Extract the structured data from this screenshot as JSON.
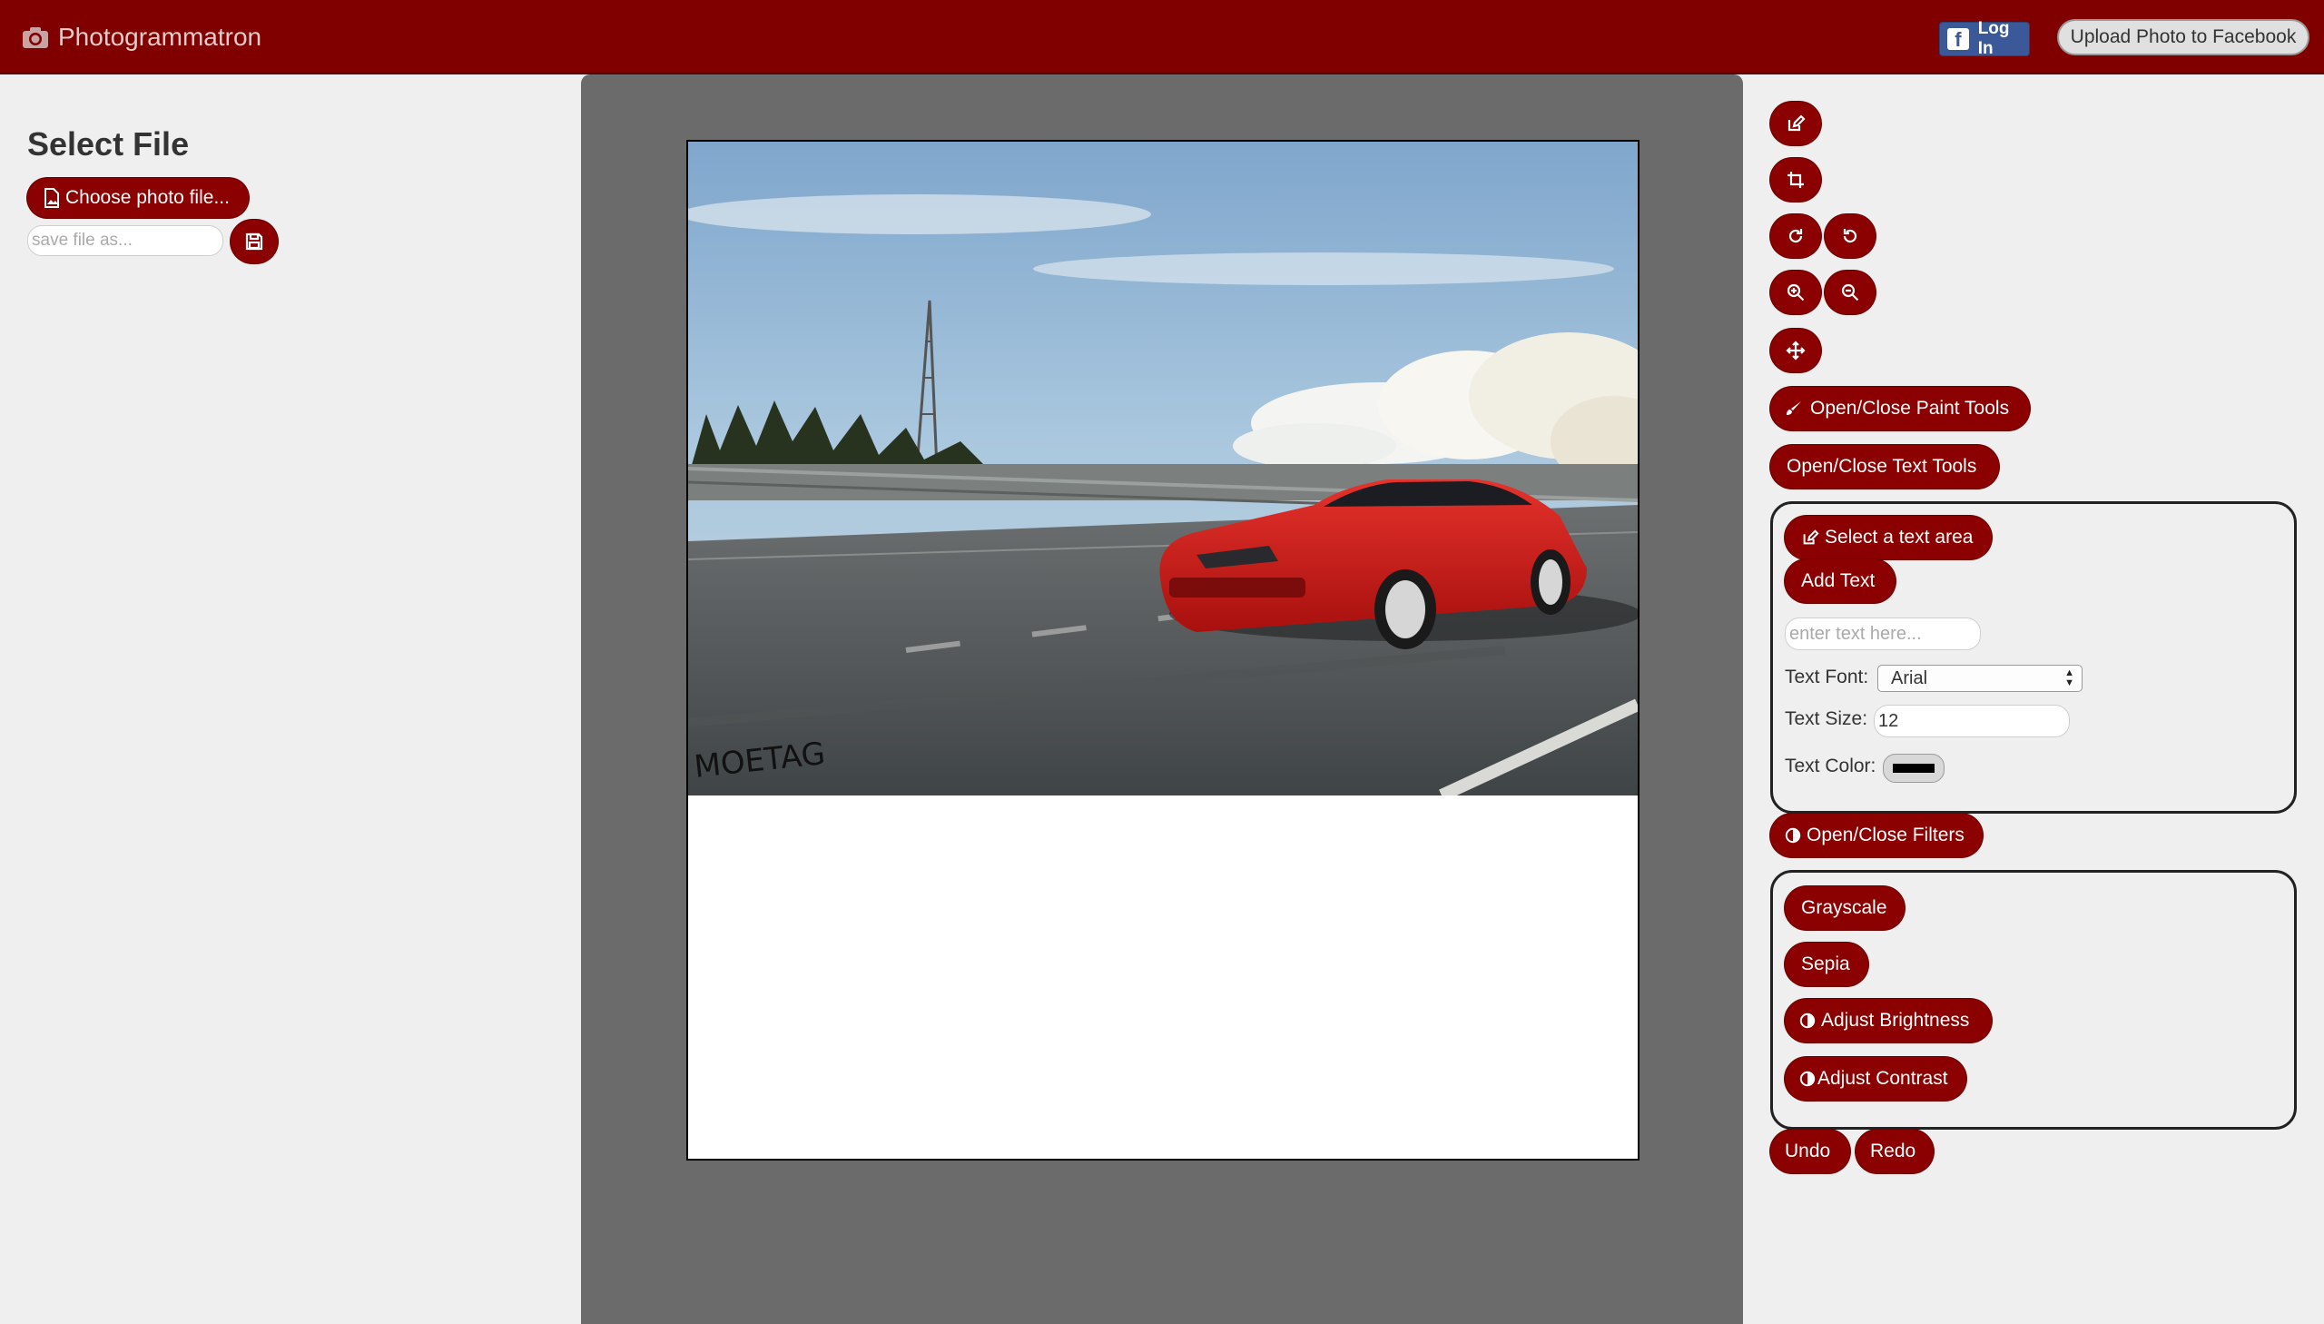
{
  "navbar": {
    "brand": "Photogrammatron",
    "fb_login": "Log In",
    "fb_logo": "f",
    "upload_facebook": "Upload Photo to Facebook"
  },
  "left_panel": {
    "title": "Select File",
    "choose_file": "Choose photo file...",
    "save_placeholder": "save file as..."
  },
  "canvas": {
    "watermark": "MOETAG"
  },
  "tools": {
    "paint_tools": "Open/Close Paint Tools",
    "text_tools": "Open/Close Text Tools",
    "select_text_area": "Select a text area",
    "add_text": "Add Text",
    "text_placeholder": "enter text here...",
    "font_label": "Text Font:",
    "font_value": "Arial",
    "size_label": "Text Size:",
    "size_value": "12",
    "color_label": "Text Color:",
    "text_color": "#000000",
    "filters": "Open/Close Filters",
    "grayscale": "Grayscale",
    "sepia": "Sepia",
    "adjust_brightness": "Adjust Brightness",
    "adjust_contrast": "Adjust Contrast",
    "undo": "Undo",
    "redo": "Redo"
  },
  "colors": {
    "primary": "#8b0000",
    "navbar": "#800000",
    "facebook": "#3b5998",
    "canvas_bg": "#6b6b6b"
  },
  "icons": [
    "camera-icon",
    "file-image-icon",
    "save-icon",
    "edit-icon",
    "crop-icon",
    "rotate-cw-icon",
    "rotate-ccw-icon",
    "zoom-in-icon",
    "zoom-out-icon",
    "move-icon",
    "brush-icon",
    "contrast-icon"
  ]
}
